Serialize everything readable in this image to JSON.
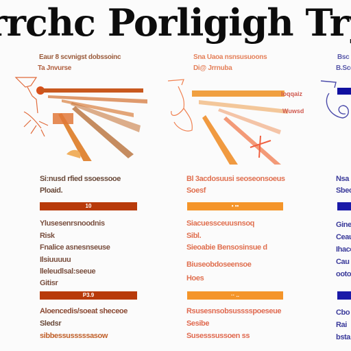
{
  "title": "rrchc Porligigh Try",
  "colors": {
    "column1": "#b83a0a",
    "column1_text": "#8a4a34",
    "column2": "#f4952a",
    "column2_text": "#e4704a",
    "column3": "#1a1aa8",
    "column3_text": "#3a3a9a",
    "title": "#0c0c0c"
  },
  "columns": [
    {
      "header_line1": "Eaur 8 scvnigst dobssoinc",
      "header_line2": "Ta Jnvurse",
      "block1_line1": "Si:nusd rfied ssoessooe",
      "block1_line2": "Ploaid.",
      "bar1_label": "10",
      "block2_line1": "Ylusesenrsnoodnis",
      "block2_line2": "Risk",
      "block2_line3": "Fnalice asnesnseuse",
      "block2_line4": "Ilsiuuuuu",
      "block3_line1": "lleleudlsal:seeue",
      "block3_line2": "Gitisr",
      "bar2_label": "P3.9",
      "block4_line1": "Aloencedis/soeat sheceoe",
      "block4_line2": "Sledsr",
      "block4_line3": "sibbessusssssasow"
    },
    {
      "header_line1": "Sna Uaoa nsnsusuoons",
      "header_line2": "Di@ Jrrnuba",
      "block1_line1": "Bl 3acdosuusi seoseonsoeus",
      "block1_line2": "Soesf",
      "bar1_label": "• ••",
      "block2_line1": "Siacuessceuusnsoq",
      "block2_line2": "Sibl.",
      "block2_line3": "Sieoabie Bensosinsue d",
      "block3_line1": "Biuseobdoseensoe",
      "block3_line2": "Hoes",
      "bar2_label": "·· ..",
      "block4_line1": "Rsusesnsobsusssspoeseue",
      "block4_line2": "Sesibe",
      "block4_line3": "Susesssussoen ss"
    },
    {
      "header_line1": "Bsc",
      "header_line2": "B.Sco",
      "block1_line1": "Nsa",
      "block1_line2": "Sbec",
      "block2_line1": "Gine",
      "block2_line2": "Ceau",
      "block2_line3": "Ihaco",
      "block2_line4": "Cau",
      "block2_line5": "ooto",
      "block4_line1": "Cbo",
      "block4_line2": "Rai",
      "block4_line3": "bsta"
    }
  ]
}
